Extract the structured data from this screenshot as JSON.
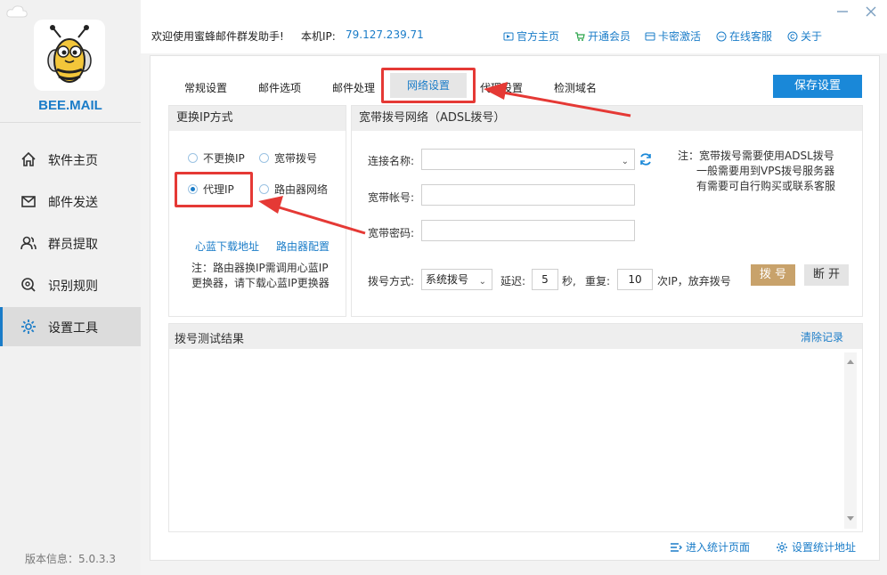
{
  "app": {
    "brand": "BEE.MAIL",
    "version_label": "版本信息：5.0.3.3"
  },
  "sidebar": {
    "items": [
      {
        "label": "软件主页",
        "icon": "home-icon"
      },
      {
        "label": "邮件发送",
        "icon": "mail-icon"
      },
      {
        "label": "群员提取",
        "icon": "users-icon"
      },
      {
        "label": "识别规则",
        "icon": "search-icon"
      },
      {
        "label": "设置工具",
        "icon": "gear-icon",
        "active": true
      }
    ]
  },
  "header": {
    "welcome": "欢迎使用蜜蜂邮件群发助手!",
    "ip_label": "本机IP:",
    "ip_value": "79.127.239.71",
    "links": [
      {
        "label": "官方主页",
        "icon": "homepage-icon"
      },
      {
        "label": "开通会员",
        "icon": "cart-icon"
      },
      {
        "label": "卡密激活",
        "icon": "card-icon"
      },
      {
        "label": "在线客服",
        "icon": "chat-icon"
      },
      {
        "label": "关于",
        "icon": "copyright-icon"
      }
    ]
  },
  "tabs": [
    "常规设置",
    "邮件选项",
    "邮件处理",
    "网络设置",
    "代理设置",
    "检测域名"
  ],
  "active_tab": "网络设置",
  "save_label": "保存设置",
  "ip_method": {
    "title": "更换IP方式",
    "options": [
      "不更换IP",
      "宽带拨号",
      "代理IP",
      "路由器网络"
    ],
    "selected": "代理IP",
    "link_download": "心蓝下载地址",
    "link_router": "路由器配置",
    "note": "注：路由器换IP需调用心蓝IP更换器，请下载心蓝IP更换器"
  },
  "adsl": {
    "title": "宽带拨号网络（ADSL拨号）",
    "conn_label": "连接名称:",
    "account_label": "宽带帐号:",
    "password_label": "宽带密码:",
    "note_lines": [
      "注：宽带拨号需要使用ADSL拨号",
      "一般需要用到VPS拨号服务器",
      "有需要可自行购买或联系客服"
    ],
    "dial_mode_label": "拨号方式:",
    "dial_mode_value": "系统拨号",
    "delay_label": "延迟:",
    "delay_value": "5",
    "delay_unit": "秒,",
    "repeat_label": "重复:",
    "repeat_value": "10",
    "repeat_suffix": "次IP，放弃拨号",
    "dial_button": "拨 号",
    "disconnect_button": "断 开"
  },
  "results": {
    "title": "拨号测试结果",
    "clear_label": "清除记录"
  },
  "footer": {
    "stats_page": "进入统计页面",
    "stats_settings": "设置统计地址"
  },
  "colors": {
    "accent": "#1a88d8",
    "highlight": "#e53935",
    "dial_button": "#c8a26b"
  }
}
